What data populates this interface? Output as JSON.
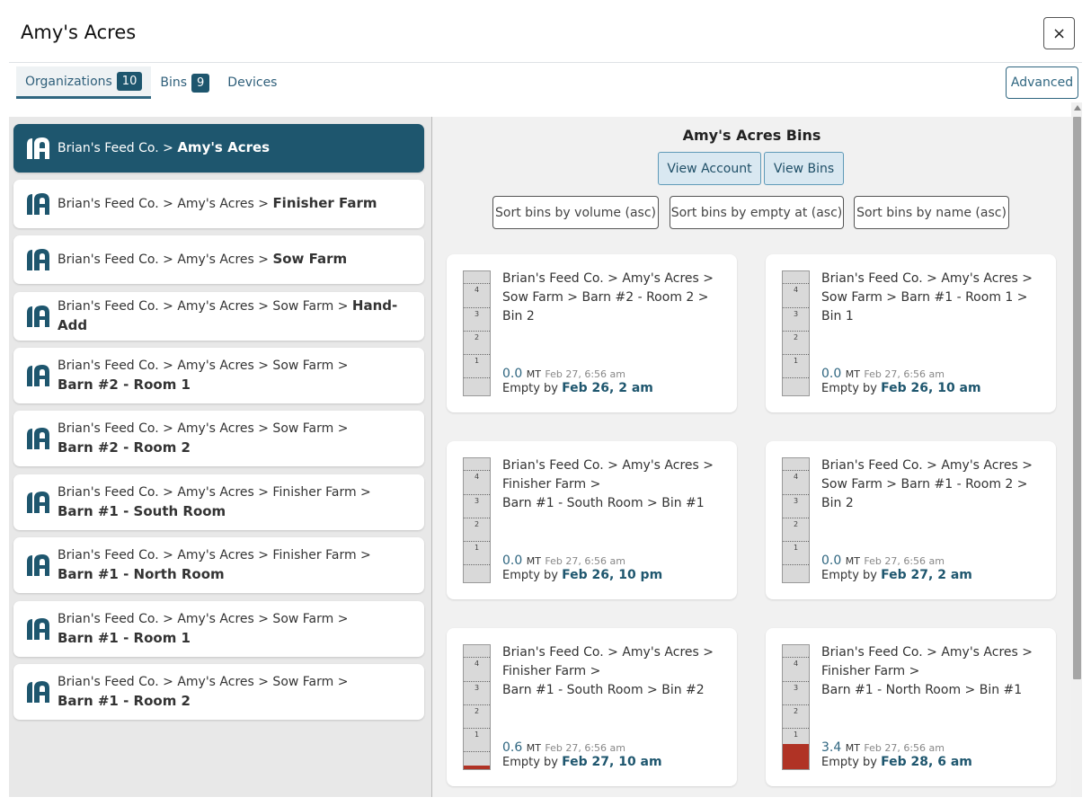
{
  "header": {
    "title": "Amy's Acres",
    "close_symbol": "×"
  },
  "tabs": [
    {
      "label": "Organizations",
      "badge": "10"
    },
    {
      "label": "Bins",
      "badge": "9"
    },
    {
      "label": "Devices"
    }
  ],
  "advanced_label": "Advanced",
  "colors": {
    "brand": "#1e566e",
    "alert_fill": "#b03325"
  },
  "organizations": [
    {
      "crumb": "Brian's Feed Co. > ",
      "name": "Amy's Acres"
    },
    {
      "crumb": "Brian's Feed Co. > Amy's Acres > ",
      "name": "Finisher Farm"
    },
    {
      "crumb": "Brian's Feed Co. > Amy's Acres > ",
      "name": "Sow Farm"
    },
    {
      "crumb": "Brian's Feed Co. > Amy's Acres > Sow Farm > ",
      "name": "Hand-Add"
    },
    {
      "crumb": "Brian's Feed Co. > Amy's Acres > Sow Farm >",
      "name": "Barn #2 - Room 1"
    },
    {
      "crumb": "Brian's Feed Co. > Amy's Acres > Sow Farm >",
      "name": "Barn #2 - Room 2"
    },
    {
      "crumb": "Brian's Feed Co. > Amy's Acres > Finisher Farm >",
      "name": "Barn #1 - South Room"
    },
    {
      "crumb": "Brian's Feed Co. > Amy's Acres > Finisher Farm >",
      "name": "Barn #1 - North Room"
    },
    {
      "crumb": "Brian's Feed Co. > Amy's Acres > Sow Farm >",
      "name": "Barn #1 - Room 1"
    },
    {
      "crumb": "Brian's Feed Co. > Amy's Acres > Sow Farm >",
      "name": "Barn #1 - Room 2"
    }
  ],
  "bins_panel": {
    "title": "Amy's Acres Bins",
    "view_account": "View Account",
    "view_bins": "View Bins",
    "sort_volume": "Sort bins by volume (asc)",
    "sort_empty": "Sort bins by empty at (asc)",
    "sort_name": "Sort bins by name (asc)"
  },
  "gauge_marks": [
    "1",
    "2",
    "3",
    "4"
  ],
  "empty_by_label": "Empty by",
  "bins": [
    {
      "path": [
        "Brian's Feed Co. > Amy's Acres >",
        "Sow Farm > Barn #2 - Room 2 >",
        "Bin 2"
      ],
      "amount": "0.0",
      "unit": "MT",
      "timestamp": "Feb 27, 6:56 am",
      "empty_by": "Feb 26, 2 am",
      "fill_fraction": 0.0
    },
    {
      "path": [
        "Brian's Feed Co. > Amy's Acres >",
        "Sow Farm > Barn #1 - Room 1 >",
        "Bin 1"
      ],
      "amount": "0.0",
      "unit": "MT",
      "timestamp": "Feb 27, 6:56 am",
      "empty_by": "Feb 26, 10 am",
      "fill_fraction": 0.0
    },
    {
      "path": [
        "Brian's Feed Co. > Amy's Acres >",
        "Finisher Farm >",
        "Barn #1 - South Room > Bin #1"
      ],
      "amount": "0.0",
      "unit": "MT",
      "timestamp": "Feb 27, 6:56 am",
      "empty_by": "Feb 26, 10 pm",
      "fill_fraction": 0.0
    },
    {
      "path": [
        "Brian's Feed Co. > Amy's Acres >",
        "Sow Farm > Barn #1 - Room 2 >",
        "Bin 2"
      ],
      "amount": "0.0",
      "unit": "MT",
      "timestamp": "Feb 27, 6:56 am",
      "empty_by": "Feb 27, 2 am",
      "fill_fraction": 0.0
    },
    {
      "path": [
        "Brian's Feed Co. > Amy's Acres >",
        "Finisher Farm >",
        "Barn #1 - South Room > Bin #2"
      ],
      "amount": "0.6",
      "unit": "MT",
      "timestamp": "Feb 27, 6:56 am",
      "empty_by": "Feb 27, 10 am",
      "fill_fraction": 0.03
    },
    {
      "path": [
        "Brian's Feed Co. > Amy's Acres >",
        "Finisher Farm >",
        "Barn #1 - North Room > Bin #1"
      ],
      "amount": "3.4",
      "unit": "MT",
      "timestamp": "Feb 27, 6:56 am",
      "empty_by": "Feb 28, 6 am",
      "fill_fraction": 0.2
    }
  ]
}
